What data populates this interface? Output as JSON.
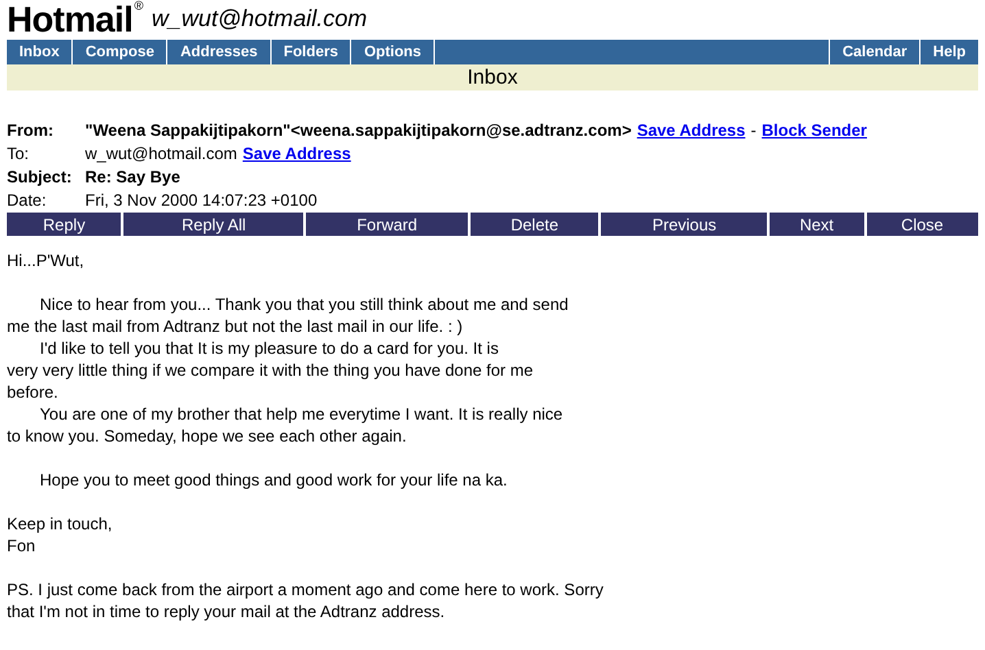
{
  "brand": {
    "name": "Hotmail",
    "mark": "®",
    "account": "w_wut@hotmail.com"
  },
  "nav": {
    "left": [
      "Inbox",
      "Compose",
      "Addresses",
      "Folders",
      "Options"
    ],
    "right": [
      "Calendar",
      "Help"
    ]
  },
  "folder_title": "Inbox",
  "headers": [
    {
      "label": "From:",
      "value": "\"Weena Sappakijtipakorn\"<weena.sappakijtipakorn@se.adtranz.com>",
      "bold": true,
      "links": [
        "Save Address",
        "Block Sender"
      ],
      "separator": "-"
    },
    {
      "label": "To:",
      "value": "w_wut@hotmail.com",
      "bold": false,
      "links": [
        "Save Address"
      ]
    },
    {
      "label": "Subject:",
      "value": "Re: Say Bye",
      "bold": true
    },
    {
      "label": "Date:",
      "value": "Fri, 3 Nov 2000 14:07:23 +0100",
      "bold": false
    }
  ],
  "actions": [
    "Reply",
    "Reply All",
    "Forward",
    "Delete",
    "Previous",
    "Next",
    "Close"
  ],
  "body": [
    {
      "paragraphs": [
        {
          "indented": false,
          "lines": [
            "Hi...P'Wut,"
          ]
        }
      ]
    },
    {
      "paragraphs": [
        {
          "indented": true,
          "lines": [
            "Nice to hear from you... Thank you that you still think about me and send",
            "me the last mail from Adtranz but not the last mail in our life. : )"
          ]
        },
        {
          "indented": true,
          "lines": [
            "I'd like to tell you that It is my pleasure to do a card for you. It is",
            "very very little thing if we compare it with the thing you have done for me",
            "before."
          ]
        },
        {
          "indented": true,
          "lines": [
            "You are one of my brother that help me everytime I want. It is really nice",
            "to know you. Someday, hope we see each other again."
          ]
        }
      ]
    },
    {
      "paragraphs": [
        {
          "indented": true,
          "lines": [
            "Hope you to meet good things and good work for your life na ka."
          ]
        }
      ]
    },
    {
      "paragraphs": [
        {
          "indented": false,
          "lines": [
            "Keep in touch,",
            "Fon"
          ]
        }
      ]
    },
    {
      "paragraphs": [
        {
          "indented": false,
          "lines": [
            "PS. I just come back from the airport a moment ago and come here to work. Sorry",
            "that I'm not in time to reply your mail at the Adtranz address."
          ]
        }
      ]
    }
  ]
}
